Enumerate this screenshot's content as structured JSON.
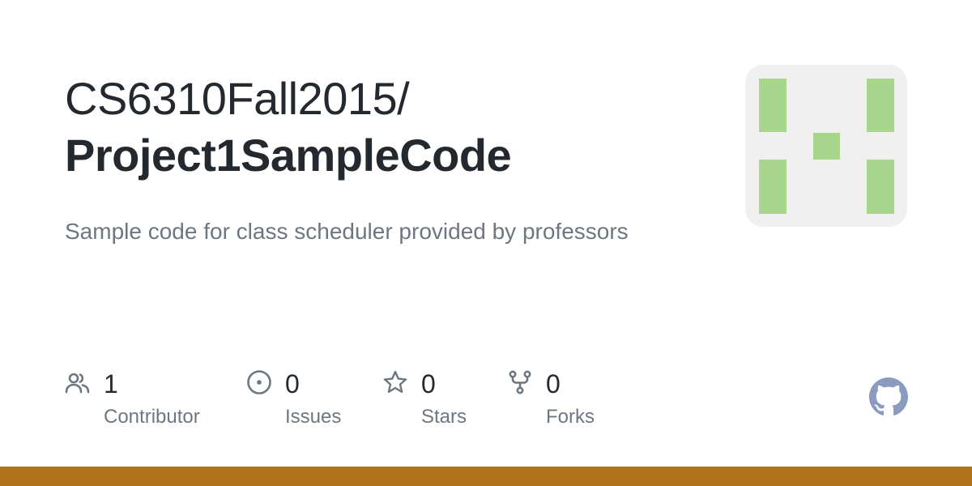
{
  "repo": {
    "owner": "CS6310Fall2015/",
    "name": "Project1SampleCode",
    "description": "Sample code for class scheduler provided by professors"
  },
  "stats": [
    {
      "value": "1",
      "label": "Contributor",
      "icon": "people-icon"
    },
    {
      "value": "0",
      "label": "Issues",
      "icon": "issue-opened-icon"
    },
    {
      "value": "0",
      "label": "Stars",
      "icon": "star-icon"
    },
    {
      "value": "0",
      "label": "Forks",
      "icon": "repo-forked-icon"
    }
  ],
  "colors": {
    "text_primary": "#24292f",
    "text_secondary": "#6e7781",
    "identicon_green": "#a6d58b",
    "identicon_bg": "#f0f0f0",
    "language_bar": "#b07219",
    "github_logo": "#8b9bbf"
  }
}
